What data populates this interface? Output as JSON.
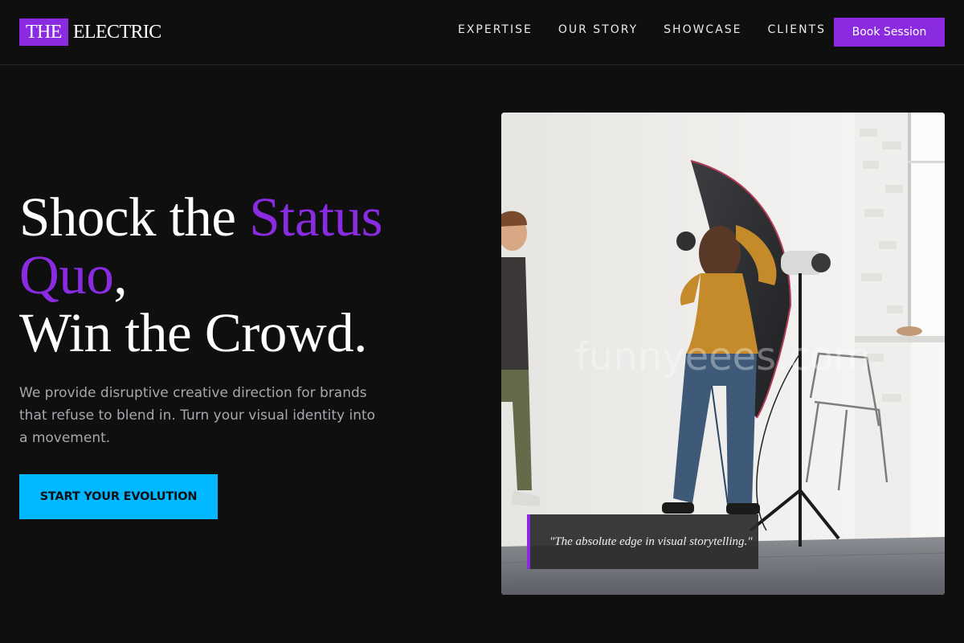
{
  "brand": {
    "mark": "THE",
    "word": "ELECTRIC",
    "accent_color": "#8a2be2"
  },
  "nav": {
    "links": [
      "EXPERTISE",
      "OUR STORY",
      "SHOWCASE",
      "CLIENTS"
    ],
    "book_label": "Book Session"
  },
  "hero": {
    "headline_part1": "Shock the ",
    "headline_accent1": "Status",
    "headline_accent2": "Quo",
    "headline_comma": ",",
    "headline_line3": "Win the Crowd.",
    "subtext": "We provide disruptive creative direction for brands that refuse to blend in. Turn your visual identity into a movement.",
    "cta_label": "START YOUR EVOLUTION",
    "cta_color": "#00b8ff"
  },
  "photo": {
    "subject": "photo-studio-shoot",
    "watermark": "funnyeees.com",
    "quote": "\"The absolute edge in visual storytelling.\""
  }
}
